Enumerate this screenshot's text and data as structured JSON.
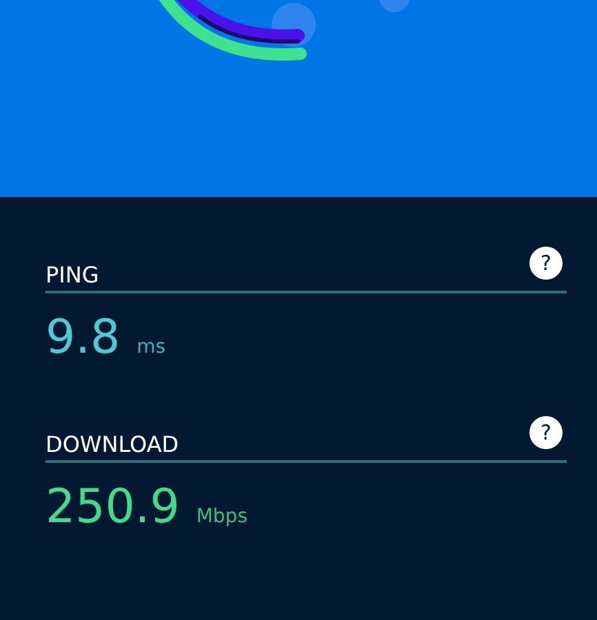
{
  "metrics": [
    {
      "label": "PING",
      "help": "?",
      "value": "9.8",
      "unit": "ms",
      "color": "#4fc9d4"
    },
    {
      "label": "DOWNLOAD",
      "help": "?",
      "value": "250.9",
      "unit": "Mbps",
      "color": "#3fdc8c"
    }
  ]
}
